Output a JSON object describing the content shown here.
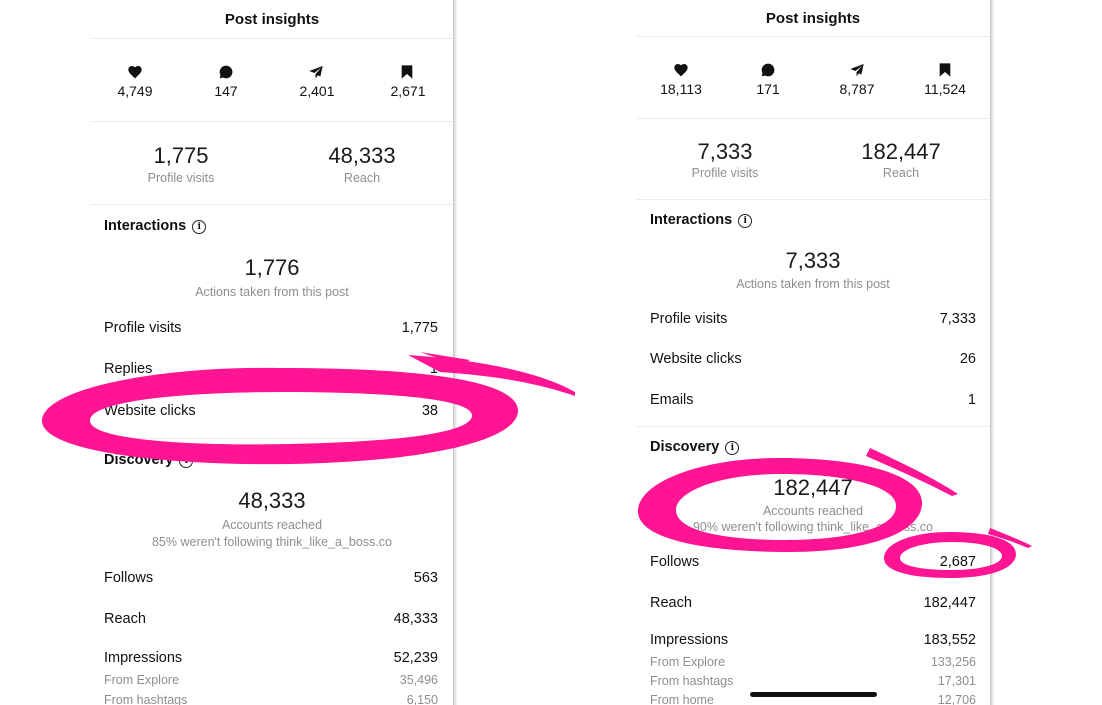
{
  "left": {
    "title": "Post insights",
    "stats": {
      "likes": "4,749",
      "comments": "147",
      "shares": "2,401",
      "saves": "2,671"
    },
    "overview": {
      "profile_visits_value": "1,775",
      "profile_visits_label": "Profile visits",
      "reach_value": "48,333",
      "reach_label": "Reach"
    },
    "interactions": {
      "heading": "Interactions",
      "total": "1,776",
      "total_label": "Actions taken from this post",
      "rows": [
        {
          "label": "Profile visits",
          "value": "1,775"
        },
        {
          "label": "Replies",
          "value": "1"
        },
        {
          "label": "Website clicks",
          "value": "38"
        }
      ]
    },
    "discovery": {
      "heading": "Discovery",
      "total": "48,333",
      "total_label": "Accounts reached",
      "following_note": "85% weren't following think_like_a_boss.co",
      "rows": [
        {
          "label": "Follows",
          "value": "563"
        },
        {
          "label": "Reach",
          "value": "48,333"
        },
        {
          "label": "Impressions",
          "value": "52,239"
        }
      ],
      "sub_rows": [
        {
          "label": "From Explore",
          "value": "35,496"
        },
        {
          "label": "From hashtags",
          "value": "6,150"
        }
      ]
    }
  },
  "right": {
    "title": "Post insights",
    "stats": {
      "likes": "18,113",
      "comments": "171",
      "shares": "8,787",
      "saves": "11,524"
    },
    "overview": {
      "profile_visits_value": "7,333",
      "profile_visits_label": "Profile visits",
      "reach_value": "182,447",
      "reach_label": "Reach"
    },
    "interactions": {
      "heading": "Interactions",
      "total": "7,333",
      "total_label": "Actions taken from this post",
      "rows": [
        {
          "label": "Profile visits",
          "value": "7,333"
        },
        {
          "label": "Website clicks",
          "value": "26"
        },
        {
          "label": "Emails",
          "value": "1"
        }
      ]
    },
    "discovery": {
      "heading": "Discovery",
      "total": "182,447",
      "total_label": "Accounts reached",
      "following_note": "90% weren't following think_like_a_boss.co",
      "rows": [
        {
          "label": "Follows",
          "value": "2,687"
        },
        {
          "label": "Reach",
          "value": "182,447"
        },
        {
          "label": "Impressions",
          "value": "183,552"
        }
      ],
      "sub_rows": [
        {
          "label": "From Explore",
          "value": "133,256"
        },
        {
          "label": "From hashtags",
          "value": "17,301"
        },
        {
          "label": "From home",
          "value": "12,706"
        }
      ]
    }
  },
  "highlight_color": "#ff1493",
  "icons": [
    "heart-icon",
    "comment-icon",
    "share-icon",
    "bookmark-icon",
    "info-icon"
  ]
}
